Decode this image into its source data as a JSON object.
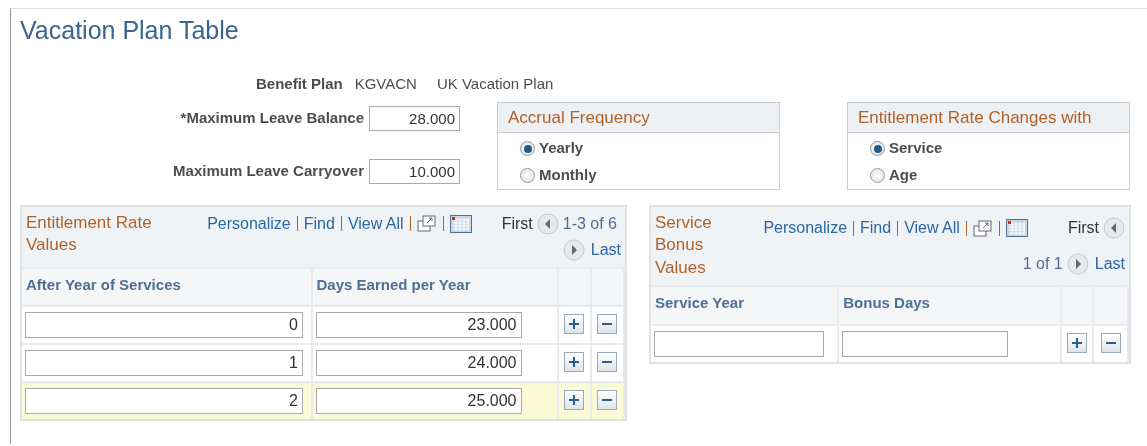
{
  "page_title": "Vacation Plan Table",
  "benefit_plan": {
    "label": "Benefit Plan",
    "code": "KGVACN",
    "description": "UK Vacation Plan"
  },
  "fields": [
    {
      "label": "*Maximum Leave Balance",
      "value": "28.000"
    },
    {
      "label": "Maximum Leave Carryover",
      "value": "10.000"
    }
  ],
  "groups": [
    {
      "title": "Accrual Frequency",
      "options": [
        {
          "label": "Yearly",
          "selected": true
        },
        {
          "label": "Monthly",
          "selected": false
        }
      ]
    },
    {
      "title": "Entitlement Rate Changes with",
      "options": [
        {
          "label": "Service",
          "selected": true
        },
        {
          "label": "Age",
          "selected": false
        }
      ]
    }
  ],
  "grids": [
    {
      "title": "Entitlement Rate Values",
      "links": [
        "Personalize",
        "Find",
        "View All"
      ],
      "nav": {
        "first": "First",
        "range": "1-3 of 6",
        "last": "Last"
      },
      "columns": [
        "After Year of Services",
        "Days Earned per Year"
      ],
      "rows": [
        {
          "cells": [
            "0",
            "23.000"
          ],
          "selected": false
        },
        {
          "cells": [
            "1",
            "24.000"
          ],
          "selected": false
        },
        {
          "cells": [
            "2",
            "25.000"
          ],
          "selected": true
        }
      ]
    },
    {
      "title": "Service Bonus Values",
      "links": [
        "Personalize",
        "Find",
        "View All"
      ],
      "nav": {
        "first": "First",
        "range": "1 of 1",
        "last": "Last"
      },
      "columns": [
        "Service Year",
        "Bonus Days"
      ],
      "rows": [
        {
          "cells": [
            "",
            ""
          ],
          "selected": false
        }
      ]
    }
  ]
}
